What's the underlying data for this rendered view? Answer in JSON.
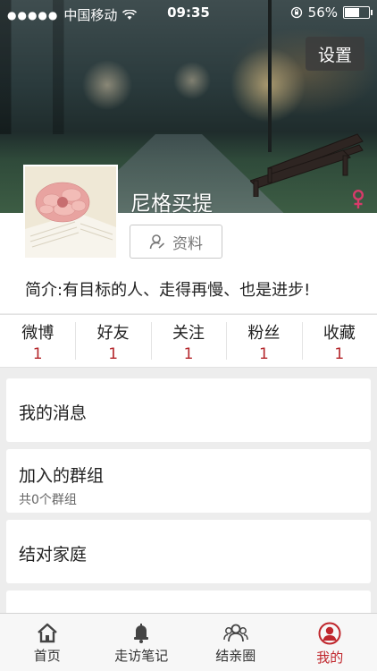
{
  "status_bar": {
    "carrier": "中国移动",
    "time": "09:35",
    "battery_percent": "56%",
    "battery_level": 0.56
  },
  "header": {
    "settings_label": "设置",
    "username": "尼格买提",
    "gender_icon": "female-icon"
  },
  "profile": {
    "info_button_label": "资料",
    "bio": "简介:有目标的人、走得再慢、也是进步!"
  },
  "stats": [
    {
      "label": "微博",
      "value": "1"
    },
    {
      "label": "好友",
      "value": "1"
    },
    {
      "label": "关注",
      "value": "1"
    },
    {
      "label": "粉丝",
      "value": "1"
    },
    {
      "label": "收藏",
      "value": "1"
    }
  ],
  "menu": {
    "messages": "我的消息",
    "groups": "加入的群组",
    "groups_count": "共0个群组",
    "family": "结对家庭"
  },
  "tabbar": {
    "tabs": [
      {
        "label": "首页",
        "icon": "home-icon"
      },
      {
        "label": "走访笔记",
        "icon": "bell-icon"
      },
      {
        "label": "结亲圈",
        "icon": "people-icon"
      },
      {
        "label": "我的",
        "icon": "person-icon"
      }
    ],
    "active_index": 3
  },
  "colors": {
    "accent": "#c0272d",
    "stat_value": "#b4262b",
    "background": "#ededed"
  }
}
